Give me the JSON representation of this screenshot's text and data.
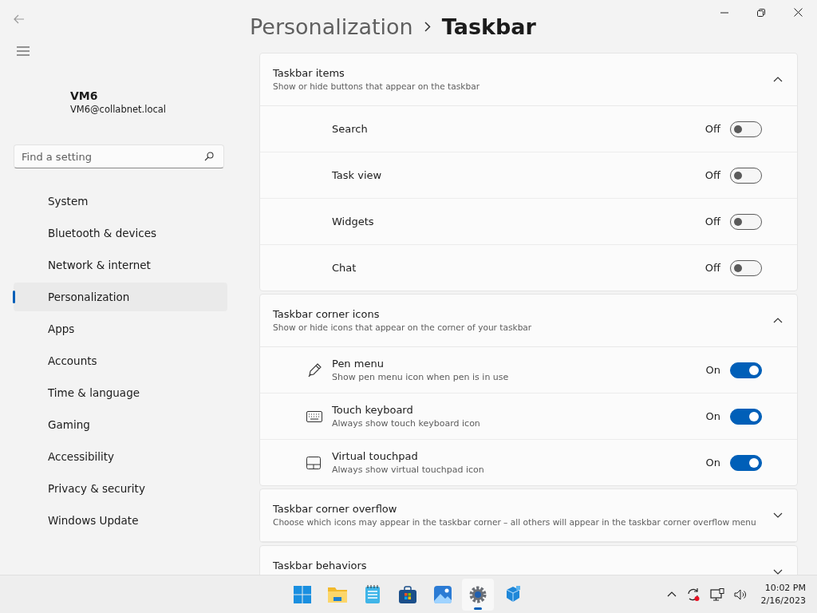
{
  "breadcrumb": {
    "parent": "Personalization",
    "current": "Taskbar"
  },
  "account": {
    "name": "VM6",
    "email": "VM6@collabnet.local"
  },
  "search": {
    "placeholder": "Find a setting"
  },
  "nav": [
    {
      "label": "System",
      "selected": false
    },
    {
      "label": "Bluetooth & devices",
      "selected": false
    },
    {
      "label": "Network & internet",
      "selected": false
    },
    {
      "label": "Personalization",
      "selected": true
    },
    {
      "label": "Apps",
      "selected": false
    },
    {
      "label": "Accounts",
      "selected": false
    },
    {
      "label": "Time & language",
      "selected": false
    },
    {
      "label": "Gaming",
      "selected": false
    },
    {
      "label": "Accessibility",
      "selected": false
    },
    {
      "label": "Privacy & security",
      "selected": false
    },
    {
      "label": "Windows Update",
      "selected": false
    }
  ],
  "sections": [
    {
      "title": "Taskbar items",
      "subtitle": "Show or hide buttons that appear on the taskbar",
      "expanded": true,
      "items": [
        {
          "label": "Search",
          "state": "Off",
          "on": false
        },
        {
          "label": "Task view",
          "state": "Off",
          "on": false
        },
        {
          "label": "Widgets",
          "state": "Off",
          "on": false
        },
        {
          "label": "Chat",
          "state": "Off",
          "on": false
        }
      ]
    },
    {
      "title": "Taskbar corner icons",
      "subtitle": "Show or hide icons that appear on the corner of your taskbar",
      "expanded": true,
      "items": [
        {
          "kind": "pen",
          "label": "Pen menu",
          "description": "Show pen menu icon when pen is in use",
          "state": "On",
          "on": true
        },
        {
          "kind": "keyboard",
          "label": "Touch keyboard",
          "description": "Always show touch keyboard icon",
          "state": "On",
          "on": true
        },
        {
          "kind": "touchpad",
          "label": "Virtual touchpad",
          "description": "Always show virtual touchpad icon",
          "state": "On",
          "on": true
        }
      ]
    },
    {
      "title": "Taskbar corner overflow",
      "subtitle": "Choose which icons may appear in the taskbar corner – all others will appear in the taskbar corner overflow menu",
      "expanded": false
    },
    {
      "title": "Taskbar behaviors",
      "expanded": false
    }
  ],
  "taskbar": {
    "apps": [
      {
        "kind": "start",
        "selected": false
      },
      {
        "kind": "folder",
        "selected": false
      },
      {
        "kind": "notepad",
        "selected": false
      },
      {
        "kind": "store",
        "selected": false
      },
      {
        "kind": "photos",
        "selected": false
      },
      {
        "kind": "settings",
        "selected": true
      },
      {
        "kind": "cubes",
        "selected": false
      }
    ],
    "time": "10:02 PM",
    "date": "2/16/2023"
  }
}
